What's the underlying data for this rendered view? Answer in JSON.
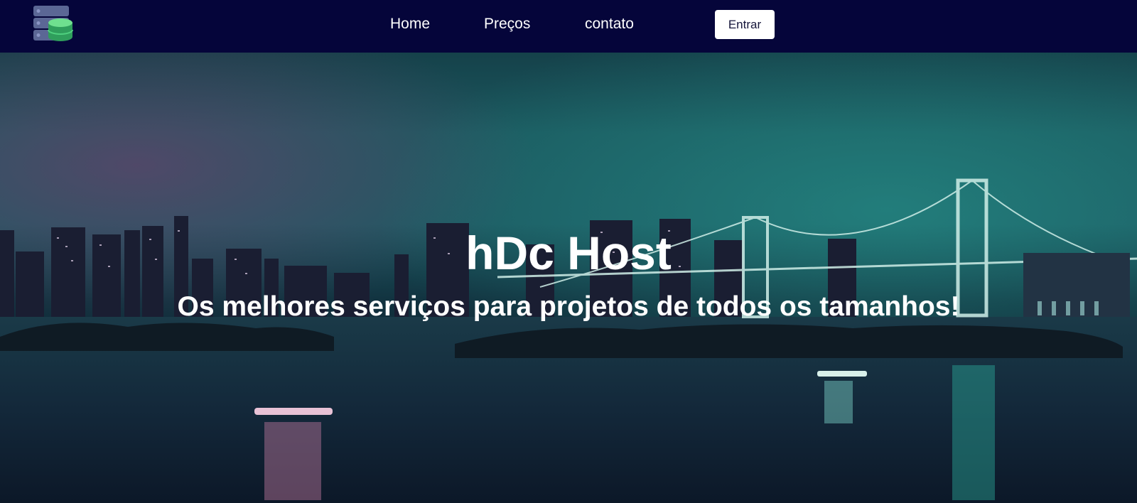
{
  "navbar": {
    "logo_icon": "server-database-icon",
    "links": [
      "Home",
      "Preços",
      "contato"
    ],
    "login_label": "Entrar"
  },
  "hero": {
    "title": "hDc Host",
    "subtitle": "Os melhores serviços para projetos de todos os tamanhos!",
    "background": "night-city-bridge-waterfront-photo"
  },
  "colors": {
    "navbar_bg": "#05053a",
    "logo_green": "#3fbf6f",
    "logo_slate": "#5a6a9a",
    "text_light": "#ffffff"
  }
}
